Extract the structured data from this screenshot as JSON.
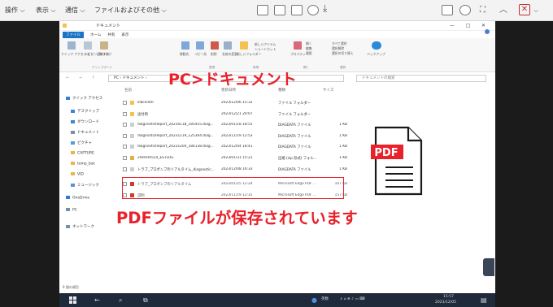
{
  "outer_toolbar": {
    "menus": [
      "操作 ⌵",
      "表示 ⌵",
      "通信 ⌵",
      "ファイルおよびその他 ⌵"
    ],
    "close_label": "✕"
  },
  "explorer": {
    "title": "ドキュメント",
    "window_controls": [
      "—",
      "□",
      "✕"
    ],
    "ribbon_tabs": [
      "ファイル",
      "ホーム",
      "共有",
      "表示"
    ],
    "ribbon_groups": [
      "クリップボード",
      "整理",
      "新規",
      "開く",
      "選択"
    ],
    "ribbon_labels": [
      "クイック アクセス にピン留めする",
      "コピー",
      "貼り付け",
      "移動先",
      "コピー先",
      "削除",
      "名前の変更",
      "新しいフォルダー",
      "新しいアイテム",
      "ショートカット",
      "プロパティ",
      "開く",
      "編集",
      "履歴",
      "すべて選択",
      "選択解除",
      "選択の切り替え",
      "バックアップ"
    ],
    "address": "PC › ドキュメント ›",
    "search_placeholder": "ドキュメントの検索",
    "columns": [
      "名前",
      "更新日時",
      "種類",
      "サイズ"
    ],
    "nav_items": [
      {
        "label": "クイック アクセス",
        "color": "#3b7ddd"
      },
      {
        "label": "デスクトップ",
        "color": "#3b86d6"
      },
      {
        "label": "ダウンロード",
        "color": "#3b86d6"
      },
      {
        "label": "ドキュメント",
        "color": "#7a8ea8"
      },
      {
        "label": "ピクチャ",
        "color": "#4aa0d8"
      },
      {
        "label": "CAPTURE",
        "color": "#e8b54a"
      },
      {
        "label": "temp_bat",
        "color": "#e8b54a"
      },
      {
        "label": "VID",
        "color": "#e8b54a"
      },
      {
        "label": "ミュージック",
        "color": "#5b8fd6"
      },
      {
        "label": "OneDrive",
        "color": "#2a7fd4"
      },
      {
        "label": "PC",
        "color": "#7a8ea8"
      },
      {
        "label": "ネットワーク",
        "color": "#7a8ea8"
      }
    ],
    "files": [
      {
        "name": "lilbcenter",
        "date": "2023/12/06 15:32",
        "type": "ファイル フォルダー",
        "size": "",
        "icon": "folder"
      },
      {
        "name": "送付用",
        "date": "2023/12/21 20:07",
        "type": "ファイル フォルダー",
        "size": "",
        "icon": "folder"
      },
      {
        "name": "diagnosticReport_20230118_185455.diag...",
        "date": "2023/01/18 18:55",
        "type": "DIAGDATA ファイル",
        "size": "1 KB",
        "icon": "file"
      },
      {
        "name": "diagnosticReport_20231119_125304.diag...",
        "date": "2023/11/19 12:53",
        "type": "DIAGDATA ファイル",
        "size": "1 KB",
        "icon": "file"
      },
      {
        "name": "diagnosticReport_20231204_184138.diag...",
        "date": "2023/12/04 18:41",
        "type": "DIAGDATA ファイル",
        "size": "1 KB",
        "icon": "file"
      },
      {
        "name": "20HFH0524_ESTLOG",
        "date": "2023/01/31 15:21",
        "type": "圧縮 (zip 形式) フォル...",
        "size": "1 KB",
        "icon": "zip"
      },
      {
        "name": "トラブ_プロポンプのリアルタイム_diagnostic...",
        "date": "2023/12/08 16:33",
        "type": "DIAGDATA ファイル",
        "size": "1 KB",
        "icon": "file"
      },
      {
        "name": "トラブ_プロポンプのリアルタイム",
        "date": "2023/01/25 12:24",
        "type": "Microsoft Edge PDF ...",
        "size": "107 KB",
        "icon": "pdf"
      },
      {
        "name": "説明",
        "date": "2023/11/19 12:35",
        "type": "Microsoft Edge PDF ...",
        "size": "157 KB",
        "icon": "pdf"
      }
    ],
    "status": "9 個の項目"
  },
  "taskbar": {
    "tray_text": "英数",
    "time": "15:57",
    "date": "2023/12/05"
  },
  "overlays": {
    "location_label": "PC>ドキュメント",
    "saved_label": "PDFファイルが保存されています",
    "pdf_badge": "PDF"
  },
  "colors": {
    "accent_red": "#e8212b",
    "folder": "#f4c24e",
    "pdf": "#d33a2c",
    "taskbar": "#1f2a3a"
  }
}
